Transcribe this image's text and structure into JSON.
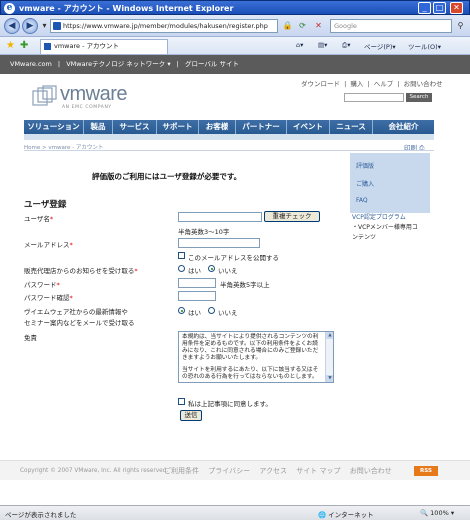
{
  "window": {
    "title": "vmware - アカウント - Windows Internet Explorer"
  },
  "browser": {
    "url": "https://www.vmware.jp/member/modules/hakusen/register.php",
    "search_placeholder": "Google",
    "tab_title": "vmware - アカウント",
    "page_menu": "ページ(P)",
    "tools_menu": "ツール(O)"
  },
  "page": {
    "topstrip": [
      "VMware.com",
      "|",
      "VMwareテクノロジ ネットワーク ▾",
      "|",
      "グローバル サイト"
    ],
    "logo": {
      "word": "vmware",
      "sub": "AN EMC COMPANY"
    },
    "utility": [
      "ダウンロード",
      "|",
      "購入",
      "|",
      "ヘルプ",
      "|",
      "お問い合わせ"
    ],
    "search_button": "Search",
    "nav": [
      "ソリューション",
      "製品",
      "サービス",
      "サポート",
      "お客様",
      "パートナー",
      "イベント",
      "ニュース",
      "会社紹介"
    ],
    "breadcrumb": "Home > vmware - アカウント",
    "print": "印刷",
    "lead": "評価版のご利用にはユーザ登録が必要です。",
    "form_title": "ユーザ登録",
    "fields": {
      "username": {
        "label": "ユーザ名",
        "req": "*",
        "check_button": "重複チェック",
        "hint": "半角英数3〜10字"
      },
      "email": {
        "label": "メールアドレス",
        "req": "*",
        "public_label": "このメールアドレスを公開する"
      },
      "dealer_notice": {
        "label": "販売代理店からのお知らせを受け取る",
        "req": "*",
        "yes": "はい",
        "no": "いいえ",
        "selected": "いいえ"
      },
      "password": {
        "label": "パスワード",
        "req": "*",
        "hint": "半角英数5字以上"
      },
      "password_confirm": {
        "label": "パスワード確認",
        "req": "*"
      },
      "seminar": {
        "label1": "ヴイエムウェア社からの最新情報や",
        "label2": "セミナー案内などをメールで受け取る",
        "yes": "はい",
        "no": "いいえ",
        "selected": "はい"
      },
      "terms": {
        "label": "免責",
        "p1": "本規約は、当サイトにより提供されるコンテンツの利用条件を定めるものです。以下の利用条件をよくお読みになり、これに同意される場合にのみご登録いただきますようお願いいたします。",
        "p2": "当サイトを利用するにあたり、以下に該当する又はその恐れのある行為を行ってはならないものとします。"
      },
      "agree_label": "私は上記事項に同意します。",
      "submit": "送信"
    },
    "side": {
      "links": [
        "評価版",
        "ご購入",
        "FAQ"
      ],
      "vcp_title": "VCP認定プログラム",
      "vcp_item1": "・VCPメンバー様専用コ",
      "vcp_item2": "ンテンツ"
    },
    "footer": {
      "copyright": "Copyright © 2007 VMware, Inc. All rights reserved.",
      "links": [
        "ご利用条件",
        "プライバシー",
        "アクセス",
        "サイト マップ",
        "お問い合わせ"
      ],
      "rss": "RSS"
    }
  },
  "status": {
    "text": "ページが表示されました",
    "zone": "インターネット",
    "zoom": "100%"
  }
}
